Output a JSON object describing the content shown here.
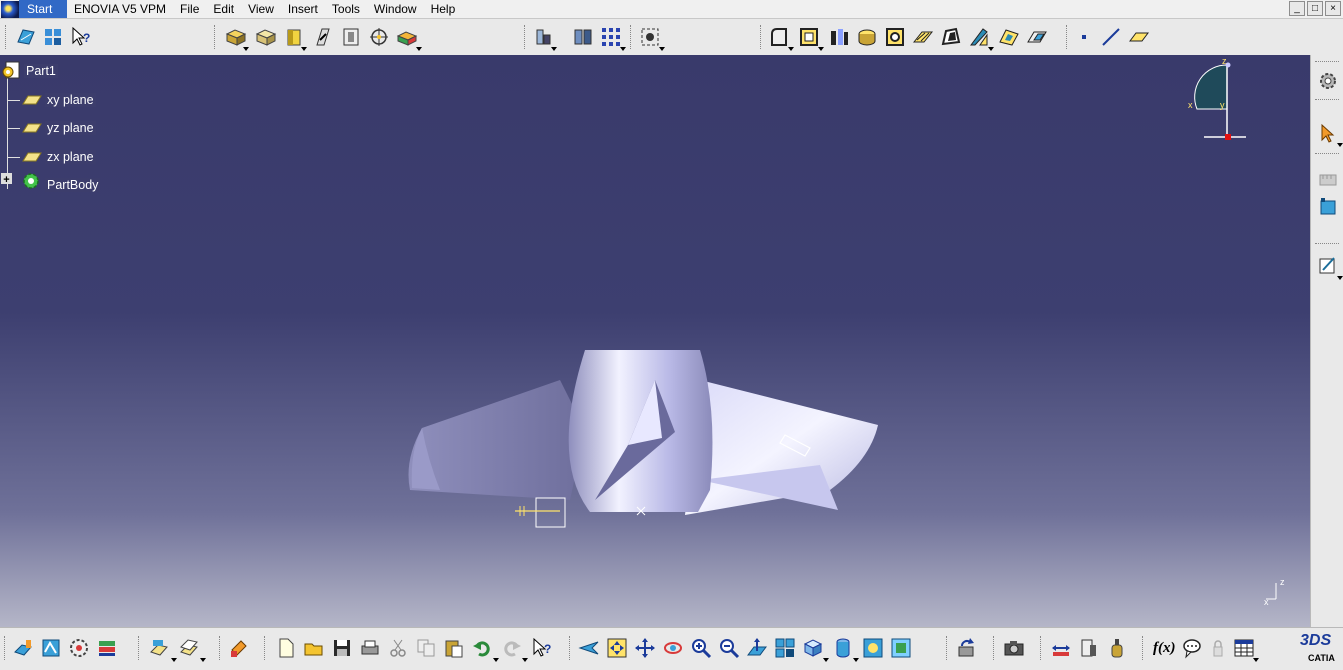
{
  "menubar": {
    "start": "Start",
    "items": [
      "ENOVIA V5 VPM",
      "File",
      "Edit",
      "View",
      "Insert",
      "Tools",
      "Window",
      "Help"
    ],
    "window_controls": [
      "_",
      "□",
      "×"
    ]
  },
  "tree": {
    "root": "Part1",
    "items": [
      "xy plane",
      "yz plane",
      "zx plane"
    ],
    "body": "PartBody",
    "expander": "+"
  },
  "compass": {
    "x_label": "x",
    "y_label": "y",
    "z_label": "z"
  },
  "triad": {
    "x_label": "x",
    "z_label": "z"
  },
  "bottom": {
    "formula_label": "f(x)"
  },
  "brand": {
    "ds": "3DS",
    "catia": "CATIA"
  },
  "colors": {
    "viewport_top": "#393a6b",
    "viewport_bottom": "#b5b6c8",
    "model_face": "#c9c9f0",
    "model_shadow": "#7c7ca6",
    "compass_fill": "#1f4a5a",
    "compass_origin": "#e01010",
    "menu_active": "#3169c6"
  }
}
